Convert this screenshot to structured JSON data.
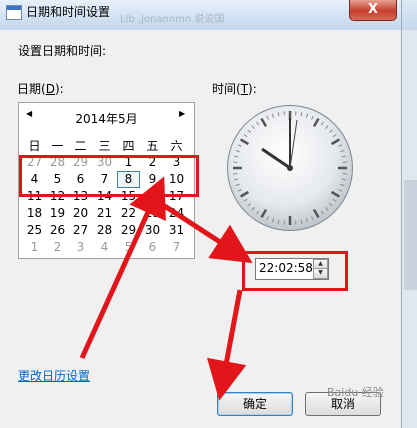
{
  "window": {
    "title": "日期和时间设置",
    "close_label": "X",
    "background_ghost_text": "Lib  ,Jonannmn  说说国"
  },
  "heading": "设置日期和时间:",
  "date_label": {
    "before": "日期(",
    "key": "D",
    "after": "):"
  },
  "time_label": {
    "before": "时间(",
    "key": "T",
    "after": "):"
  },
  "calendar": {
    "prev_arrow": "◀",
    "next_arrow": "▶",
    "month_title": "2014年5月",
    "weekdays": [
      "日",
      "一",
      "二",
      "三",
      "四",
      "五",
      "六"
    ],
    "weeks": [
      [
        "27",
        "28",
        "29",
        "30",
        "1",
        "2",
        "3"
      ],
      [
        "4",
        "5",
        "6",
        "7",
        "8",
        "9",
        "10"
      ],
      [
        "11",
        "12",
        "13",
        "14",
        "15",
        "16",
        "17"
      ],
      [
        "18",
        "19",
        "20",
        "21",
        "22",
        "23",
        "24"
      ],
      [
        "25",
        "26",
        "27",
        "28",
        "29",
        "30",
        "31"
      ],
      [
        "1",
        "2",
        "3",
        "4",
        "5",
        "6",
        "7"
      ]
    ],
    "selected_day": "8"
  },
  "time": {
    "value": "22:02:58",
    "spin_up": "▲",
    "spin_down": "▼"
  },
  "change_calendar_link": "更改日历设置",
  "buttons": {
    "ok": "确定",
    "cancel": "取消"
  },
  "watermark": "Baidu 经验",
  "annotation_color": "#e2161a"
}
